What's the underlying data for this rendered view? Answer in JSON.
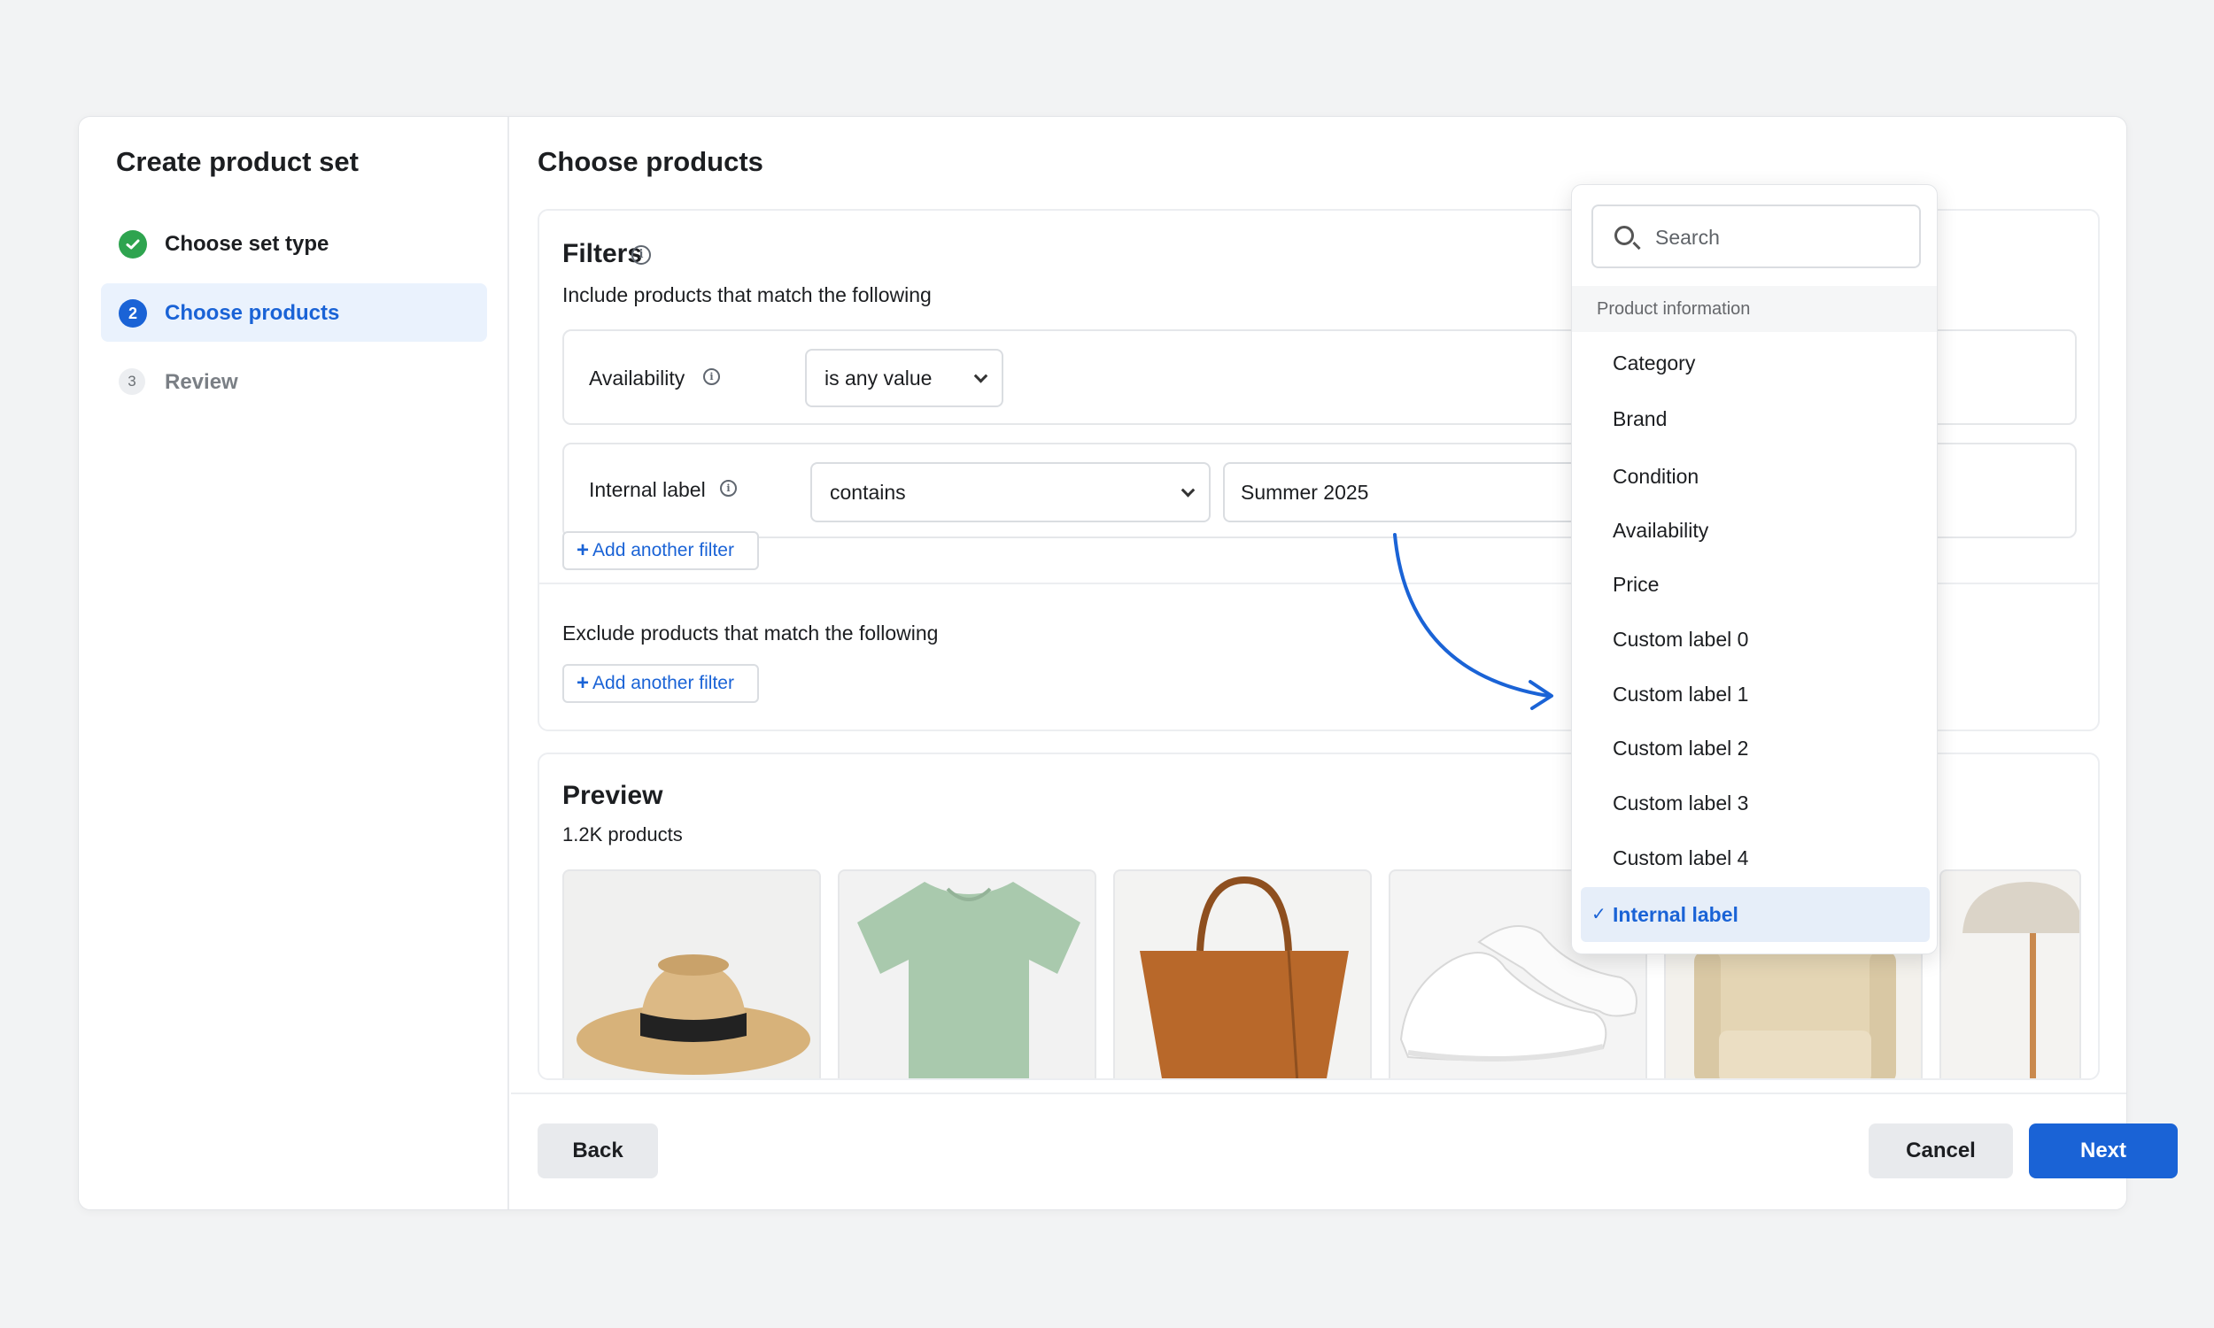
{
  "sidebar": {
    "title": "Create product set",
    "steps": [
      {
        "number": "✓",
        "label": "Choose set type",
        "state": "done"
      },
      {
        "number": "2",
        "label": "Choose products",
        "state": "current"
      },
      {
        "number": "3",
        "label": "Review",
        "state": "pending"
      }
    ]
  },
  "main": {
    "title": "Choose products",
    "filters": {
      "title": "Filters",
      "include_text": "Include products that match the following",
      "exclude_text": "Exclude products that match the following",
      "rows": [
        {
          "label": "Availability",
          "operator": "is any value"
        },
        {
          "label": "Internal label",
          "operator": "contains",
          "value": "Summer 2025"
        }
      ],
      "add_filter_label": "Add another filter"
    },
    "preview": {
      "title": "Preview",
      "count": "1.2K products",
      "items": [
        "hat",
        "t-shirt",
        "tote bag",
        "sneakers",
        "chair",
        "lamp"
      ]
    }
  },
  "footer": {
    "back_label": "Back",
    "cancel_label": "Cancel",
    "next_label": "Next"
  },
  "dropdown": {
    "search_placeholder": "Search",
    "section_label": "Product information",
    "items": [
      "Category",
      "Brand",
      "Condition",
      "Availability",
      "Price",
      "Custom label 0",
      "Custom label 1",
      "Custom label 2",
      "Custom label 3",
      "Custom label 4",
      "Internal label"
    ],
    "selected": "Internal label"
  },
  "colors": {
    "accent": "#1a63d6",
    "success": "#2ea44f",
    "selected_bg": "#e6eef9"
  }
}
